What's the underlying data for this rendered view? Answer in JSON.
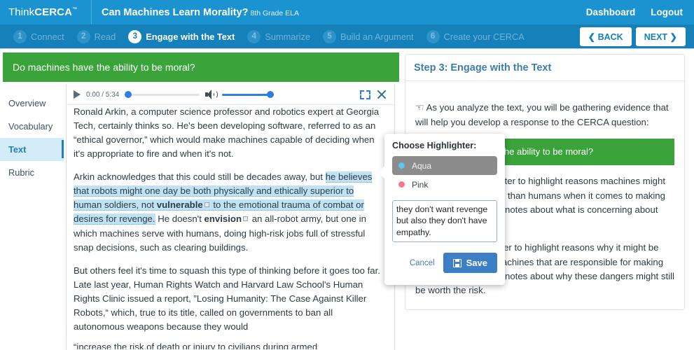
{
  "topbar": {
    "logo_light": "Think",
    "logo_bold": "CERCA",
    "logo_tm": "™",
    "doc_title": "Can Machines Learn Morality?",
    "doc_subtitle": "8th Grade ELA",
    "dashboard_label": "Dashboard",
    "logout_label": "Logout"
  },
  "steps": {
    "items": [
      {
        "num": "1",
        "label": "Connect",
        "active": false
      },
      {
        "num": "2",
        "label": "Read",
        "active": false
      },
      {
        "num": "3",
        "label": "Engage with the Text",
        "active": true
      },
      {
        "num": "4",
        "label": "Summarize",
        "active": false
      },
      {
        "num": "5",
        "label": "Build an Argument",
        "active": false
      },
      {
        "num": "6",
        "label": "Create your CERCA",
        "active": false
      }
    ],
    "back_label": "❮ BACK",
    "next_label": "NEXT ❯"
  },
  "left": {
    "cerca_question": "Do machines have the ability to be moral?",
    "sidenav": [
      {
        "label": "Overview",
        "active": false
      },
      {
        "label": "Vocabulary",
        "active": false
      },
      {
        "label": "Text",
        "active": true
      },
      {
        "label": "Rubric",
        "active": false
      }
    ],
    "player": {
      "time": "0:00 / 5:34",
      "play_icon": "play-icon",
      "volume_icon": "speaker-icon",
      "fullscreen_icon": "expand-icon",
      "close_icon": "close-icon"
    },
    "article": {
      "p1": "Ronald Arkin, a computer science professor and robotics expert at Georgia Tech, certainly thinks so. He's been developing software, referred to as an “ethical governor,” which would make machines capable of deciding when it's appropriate to fire and when it's not.",
      "p2_pre": "Arkin acknowledges that this could still be decades away, but ",
      "p2_hl_a": "he believes that robots might one day be both physically and ethically superior to human soldiers, not ",
      "p2_hl_bold": "vulnerable",
      "p2_hl_b": " to the emotional trauma of combat or desires for revenge.",
      "p2_mid": " He doesn't ",
      "p2_bold2": "envision",
      "p2_post": " an all-robot army, but one in which machines serve with humans, doing high-risk jobs full of stressful snap decisions, such as clearing buildings.",
      "p3": "But others feel it's time to squash this type of thinking before it goes too far. Late last year, Human Rights Watch and Harvard Law School's Human Rights Clinic issued a report, ”Losing Humanity: The Case Against Killer Robots,“ which, true to its title, called on governments to ban all autonomous weapons because they would",
      "p4_clipped": "“increase the risk of death or injury to civilians during armed"
    }
  },
  "right": {
    "header": "Step 3: Engage with the Text",
    "intro": "As you analyze the text, you will be gathering evidence that will help you develop a response to the CERCA question:",
    "cerca_question": "Do machines have the ability to be moral?",
    "para1": "Use the aqua highlighter to highlight reasons machines might make better decisions than humans when it comes to making ethical choices. Write notes about what is concerning about this",
    "para2": "Use the pink highlighter to highlight reasons why it might be dangerous to have machines that are responsible for making ethical choices. Write notes about why these dangers might still be worth the risk."
  },
  "popover": {
    "title": "Choose Highlighter:",
    "options": [
      {
        "label": "Aqua",
        "color": "#5cc6e8",
        "selected": true
      },
      {
        "label": "Pink",
        "color": "#f4798f",
        "selected": false
      }
    ],
    "note_value": "they don't want revenge but also they don't have empathy.",
    "note_placeholder": "",
    "cancel_label": "Cancel",
    "save_label": "Save"
  },
  "colors": {
    "brand_blue": "#1b93d1",
    "steps_blue": "#1580ba",
    "green": "#3aa33a",
    "aqua_highlight": "#bfe3f5",
    "save_blue": "#3d7fc4",
    "active_nav": "#d4ecf8"
  }
}
